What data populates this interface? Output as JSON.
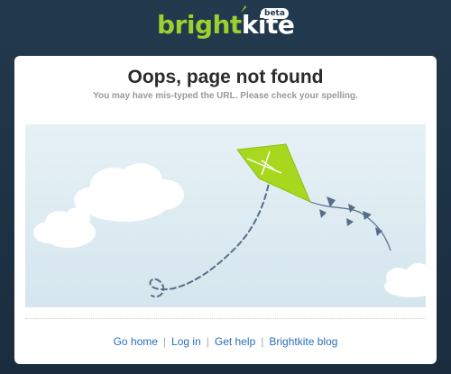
{
  "header": {
    "logo_part1": "bright",
    "logo_part2": "kite",
    "badge": "beta"
  },
  "error": {
    "title": "Oops, page not found",
    "message": "You may have mis-typed the URL. Please check your spelling."
  },
  "footer": {
    "links": [
      {
        "label": "Go home"
      },
      {
        "label": "Log in"
      },
      {
        "label": "Get help"
      },
      {
        "label": "Brightkite blog"
      }
    ],
    "separator": "|"
  },
  "colors": {
    "page_bg": "#23394d",
    "brand_green": "#9bd12f",
    "link": "#2a6fb8",
    "kite": "#a8d81e"
  }
}
